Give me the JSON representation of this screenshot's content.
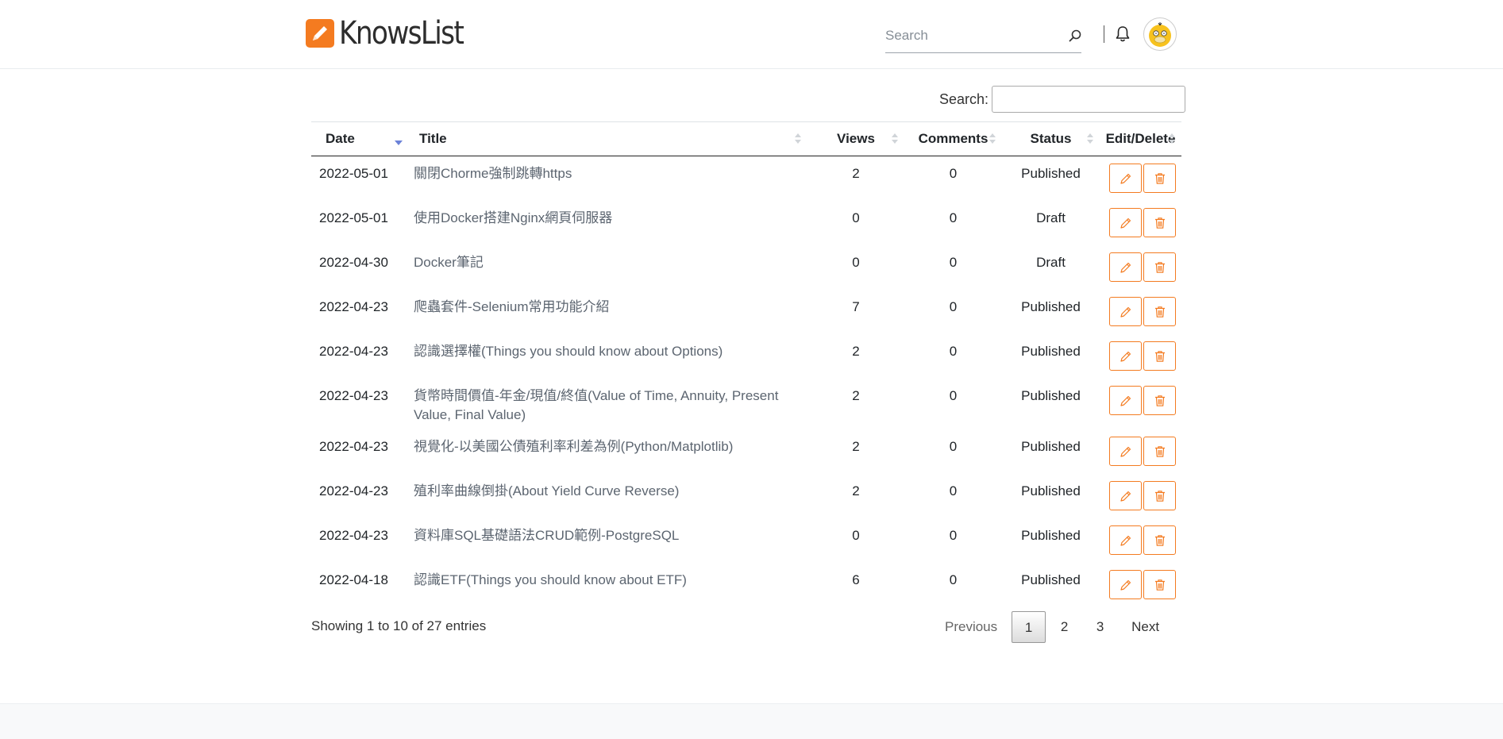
{
  "header": {
    "brand": "KnowsList",
    "search_placeholder": "Search"
  },
  "table": {
    "filter_label": "Search:",
    "columns": [
      "Date",
      "Title",
      "Views",
      "Comments",
      "Status",
      "Edit/Delete"
    ],
    "rows": [
      {
        "date": "2022-05-01",
        "title": "關閉Chorme強制跳轉https",
        "views": "2",
        "comments": "0",
        "status": "Published"
      },
      {
        "date": "2022-05-01",
        "title": "使用Docker搭建Nginx網頁伺服器",
        "views": "0",
        "comments": "0",
        "status": "Draft"
      },
      {
        "date": "2022-04-30",
        "title": "Docker筆記",
        "views": "0",
        "comments": "0",
        "status": "Draft"
      },
      {
        "date": "2022-04-23",
        "title": "爬蟲套件-Selenium常用功能介紹",
        "views": "7",
        "comments": "0",
        "status": "Published"
      },
      {
        "date": "2022-04-23",
        "title": "認識選擇權(Things you should know about Options)",
        "views": "2",
        "comments": "0",
        "status": "Published"
      },
      {
        "date": "2022-04-23",
        "title": "貨幣時間價值-年金/現值/終值(Value of Time, Annuity, Present Value, Final Value)",
        "views": "2",
        "comments": "0",
        "status": "Published"
      },
      {
        "date": "2022-04-23",
        "title": "視覺化-以美國公債殖利率利差為例(Python/Matplotlib)",
        "views": "2",
        "comments": "0",
        "status": "Published"
      },
      {
        "date": "2022-04-23",
        "title": "殖利率曲線倒掛(About Yield Curve Reverse)",
        "views": "2",
        "comments": "0",
        "status": "Published"
      },
      {
        "date": "2022-04-23",
        "title": "資料庫SQL基礎語法CRUD範例-PostgreSQL",
        "views": "0",
        "comments": "0",
        "status": "Published"
      },
      {
        "date": "2022-04-18",
        "title": "認識ETF(Things you should know about ETF)",
        "views": "6",
        "comments": "0",
        "status": "Published"
      }
    ],
    "info": "Showing 1 to 10 of 27 entries",
    "pagination": {
      "previous": "Previous",
      "pages": [
        "1",
        "2",
        "3"
      ],
      "current": "1",
      "next": "Next"
    }
  },
  "colors": {
    "accent": "#f47b20",
    "link": "#5c6570",
    "sort_active": "#6b82d8"
  }
}
